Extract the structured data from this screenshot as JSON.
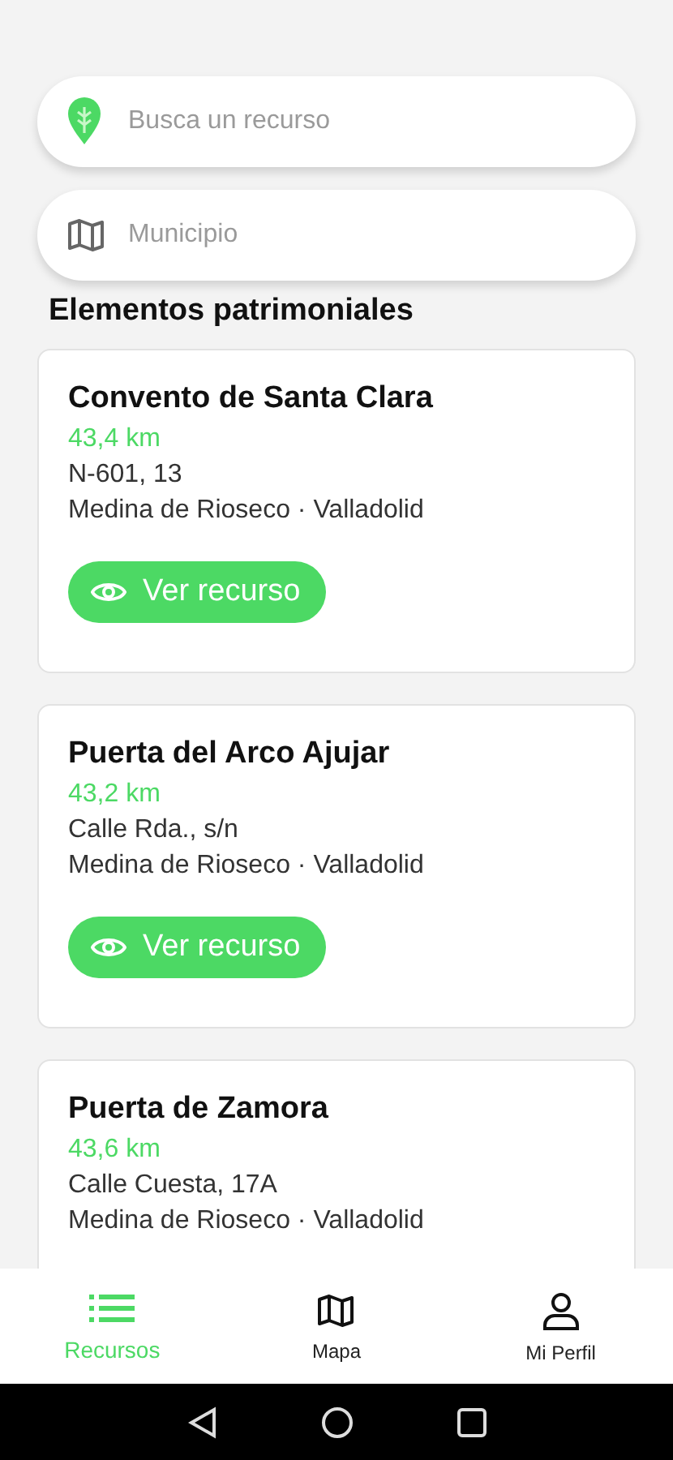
{
  "search": {
    "placeholder": "Busca un recurso"
  },
  "municipality": {
    "placeholder": "Municipio"
  },
  "section_title": "Elementos patrimoniales",
  "resources": [
    {
      "name": "Convento de Santa Clara",
      "distance": "43,4 km",
      "address": "N-601, 13",
      "location": "Medina de Rioseco · Valladolid",
      "button": "Ver recurso"
    },
    {
      "name": "Puerta del Arco Ajujar",
      "distance": "43,2 km",
      "address": "Calle Rda., s/n",
      "location": "Medina de Rioseco · Valladolid",
      "button": "Ver recurso"
    },
    {
      "name": "Puerta de Zamora",
      "distance": "43,6 km",
      "address": "Calle Cuesta, 17A",
      "location": "Medina de Rioseco · Valladolid"
    }
  ],
  "tabs": [
    {
      "kind": "list",
      "label": "Recursos",
      "selected": true
    },
    {
      "kind": "map",
      "label": "Mapa",
      "selected": false
    },
    {
      "kind": "profile",
      "label": "Mi Perfil",
      "selected": false
    }
  ]
}
